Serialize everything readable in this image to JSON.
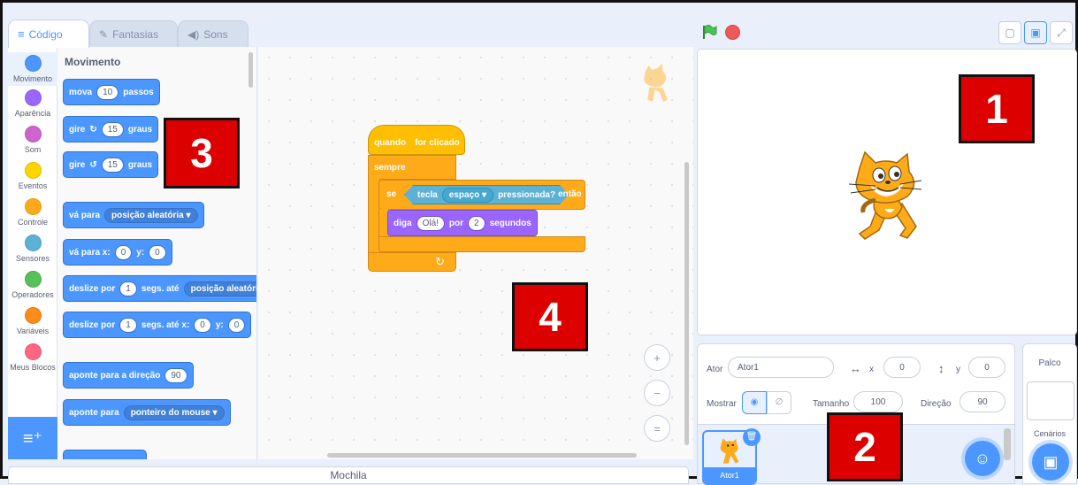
{
  "tabs": [
    {
      "label": "Código",
      "icon": "code-icon"
    },
    {
      "label": "Fantasias",
      "icon": "brush-icon"
    },
    {
      "label": "Sons",
      "icon": "speaker-icon"
    }
  ],
  "categories": [
    {
      "label": "Movimento",
      "color": "#4c97ff"
    },
    {
      "label": "Aparência",
      "color": "#9966ff"
    },
    {
      "label": "Som",
      "color": "#cf63cf"
    },
    {
      "label": "Eventos",
      "color": "#ffd500"
    },
    {
      "label": "Controle",
      "color": "#ffab19"
    },
    {
      "label": "Sensores",
      "color": "#5cb1d6"
    },
    {
      "label": "Operadores",
      "color": "#59c059"
    },
    {
      "label": "Variáveis",
      "color": "#ff8c1a"
    },
    {
      "label": "Meus Blocos",
      "color": "#ff6680"
    }
  ],
  "palette": {
    "title": "Movimento",
    "move": {
      "a": "mova",
      "n": "10",
      "b": "passos"
    },
    "turn_right": {
      "a": "gire",
      "n": "15",
      "b": "graus"
    },
    "turn_left": {
      "a": "gire",
      "n": "15",
      "b": "graus"
    },
    "goto": {
      "a": "vá para",
      "d": "posição aleatória"
    },
    "goto_xy": {
      "a": "vá para x:",
      "x": "0",
      "yl": "y:",
      "y": "0"
    },
    "glide": {
      "a": "deslize por",
      "n": "1",
      "b": "segs. até",
      "d": "posição aleatória"
    },
    "glide_xy": {
      "a": "deslize por",
      "n": "1",
      "b": "segs. até x:",
      "x": "0",
      "yl": "y:",
      "y": "0"
    },
    "point_dir": {
      "a": "aponte para a direção",
      "n": "90"
    },
    "point_to": {
      "a": "aponte para",
      "d": "ponteiro do mouse"
    }
  },
  "script": {
    "hat_a": "quando",
    "hat_b": "for clicado",
    "forever": "sempre",
    "if": "se",
    "key": "tecla",
    "key_val": "espaço",
    "pressed": "pressionada?",
    "then": "então",
    "say": "diga",
    "say_msg": "Olá!",
    "for": "por",
    "secs": "2",
    "secs_label": "segundos"
  },
  "zoom": {
    "in": "+",
    "out": "−",
    "reset": "="
  },
  "backpack": "Mochila",
  "sprite": {
    "label": "Ator",
    "name": "Ator1",
    "x_label": "x",
    "x": "0",
    "y_label": "y",
    "y": "0",
    "show_label": "Mostrar",
    "size_label": "Tamanho",
    "size": "100",
    "dir_label": "Direção",
    "dir": "90",
    "thumb_name": "Ator1"
  },
  "stage_panel": {
    "title": "Palco",
    "backdrops": "Cenários"
  },
  "badges": [
    "1",
    "2",
    "3",
    "4"
  ],
  "colors": {
    "motion": "#4c97ff",
    "events": "#ffbf00",
    "control": "#ffab19",
    "sensing": "#5cb1d6",
    "looks": "#9966ff",
    "badge": "#dd0000"
  }
}
